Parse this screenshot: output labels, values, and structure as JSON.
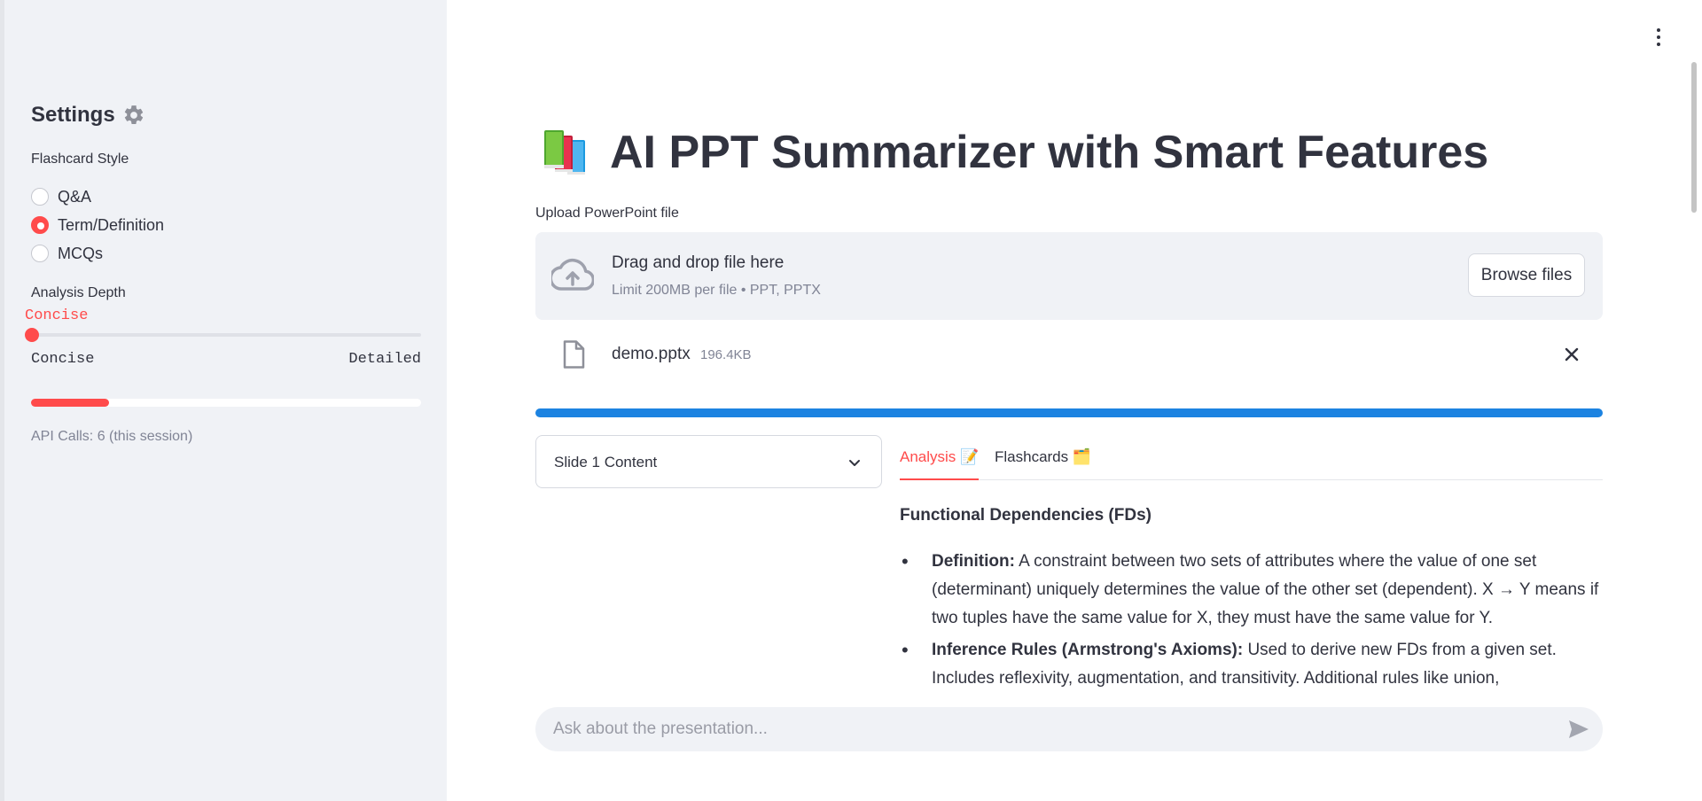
{
  "sidebar": {
    "title": "Settings",
    "flashcard_label": "Flashcard Style",
    "flashcard_options": [
      "Q&A",
      "Term/Definition",
      "MCQs"
    ],
    "flashcard_selected": "Term/Definition",
    "depth_label": "Analysis Depth",
    "depth_value": "Concise",
    "depth_min": "Concise",
    "depth_max": "Detailed",
    "usage_progress_fraction": 0.2,
    "api_calls": "API Calls: 6 (this session)"
  },
  "main": {
    "title": "AI PPT Summarizer with Smart Features",
    "upload_label": "Upload PowerPoint file",
    "dropzone_title": "Drag and drop file here",
    "dropzone_sub": "Limit 200MB per file • PPT, PPTX",
    "browse_label": "Browse files",
    "file_name": "demo.pptx",
    "file_size": "196.4KB",
    "upload_progress_fraction": 1.0,
    "slide_select_value": "Slide 1 Content",
    "tabs": [
      "Analysis 📝",
      "Flashcards 🗂️"
    ],
    "active_tab": "Analysis 📝",
    "analysis": {
      "heading": "Functional Dependencies (FDs)",
      "items": [
        {
          "term": "Definition:",
          "text": " A constraint between two sets of attributes where the value of one set (determinant) uniquely determines the value of the other set (dependent). X → Y means if two tuples have the same value for X, they must have the same value for Y."
        },
        {
          "term": "Inference Rules (Armstrong's Axioms):",
          "text": " Used to derive new FDs from a given set. Includes reflexivity, augmentation, and transitivity. Additional rules like union, decomposition, and"
        }
      ]
    },
    "chat_placeholder": "Ask about the presentation..."
  },
  "colors": {
    "accent": "#ff4b4b",
    "progress_blue": "#1c83e1",
    "sidebar_bg": "#f0f2f6",
    "text": "#31333f",
    "muted": "#808495"
  },
  "icons": [
    "gear-icon",
    "books-icon",
    "cloud-upload-icon",
    "file-icon",
    "close-icon",
    "chevron-down-icon",
    "send-icon",
    "more-vert-icon"
  ]
}
